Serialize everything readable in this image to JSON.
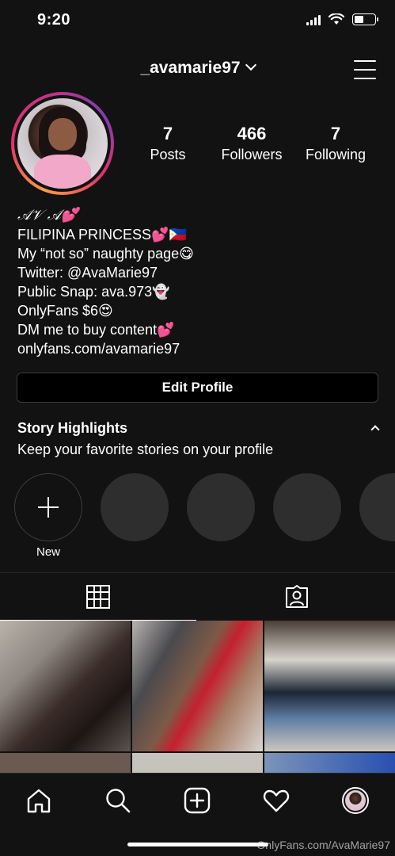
{
  "status_bar": {
    "time": "9:20",
    "battery_level": 0.45
  },
  "header": {
    "username": "_avamarie97"
  },
  "stats": [
    {
      "value": "7",
      "label": "Posts"
    },
    {
      "value": "466",
      "label": "Followers"
    },
    {
      "value": "7",
      "label": "Following"
    }
  ],
  "bio": {
    "name": "𝒜𝒱 𝒜💕",
    "lines": [
      "FILIPINA PRINCESS💕🇵🇭",
      "My “not so” naughty page😋",
      "Twitter: @AvaMarie97",
      "Public Snap: ava.973👻",
      "OnlyFans $6😍",
      "DM me to buy content💕",
      "onlyfans.com/avamarie97"
    ]
  },
  "edit_profile_label": "Edit Profile",
  "highlights": {
    "title": "Story Highlights",
    "subtitle": "Keep your favorite stories on your profile",
    "new_label": "New"
  },
  "watermark": "OnlyFans.com/AvaMarie97",
  "icons": {
    "menu": "hamburger-icon",
    "grid": "grid-icon",
    "tagged": "tagged-person-icon",
    "home": "home-icon",
    "search": "search-icon",
    "create": "plus-square-icon",
    "activity": "heart-icon",
    "profile": "profile-avatar"
  },
  "colors": {
    "background": "#121212",
    "ring_start": "#f9a03f",
    "ring_end": "#833ab4"
  }
}
